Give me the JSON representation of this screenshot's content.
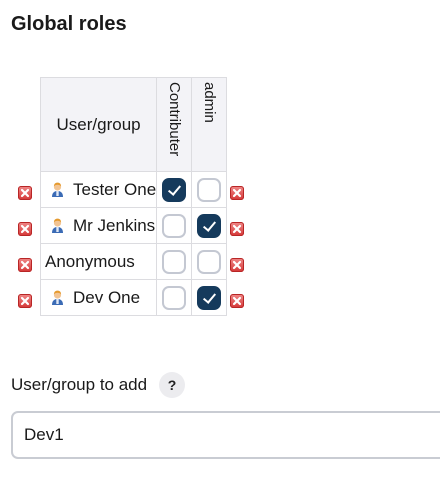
{
  "section": {
    "title": "Global roles"
  },
  "matrix": {
    "user_column_header": "User/group",
    "roles": [
      "Contributer",
      "admin"
    ],
    "rows": [
      {
        "name": "Tester One",
        "has_user_icon": true,
        "roles": [
          true,
          false
        ]
      },
      {
        "name": "Mr Jenkins",
        "has_user_icon": true,
        "roles": [
          false,
          true
        ]
      },
      {
        "name": "Anonymous",
        "has_user_icon": false,
        "roles": [
          false,
          false
        ]
      },
      {
        "name": "Dev One",
        "has_user_icon": true,
        "roles": [
          false,
          true
        ]
      }
    ],
    "row_icon": "user-icon",
    "delete_icon": "remove-red-x-icon"
  },
  "add": {
    "label": "User/group to add",
    "help_label": "?",
    "value": "Dev1"
  },
  "colors": {
    "checked": "#153a5c",
    "delete": "#d43636",
    "header_bg": "#f3f3f7"
  }
}
